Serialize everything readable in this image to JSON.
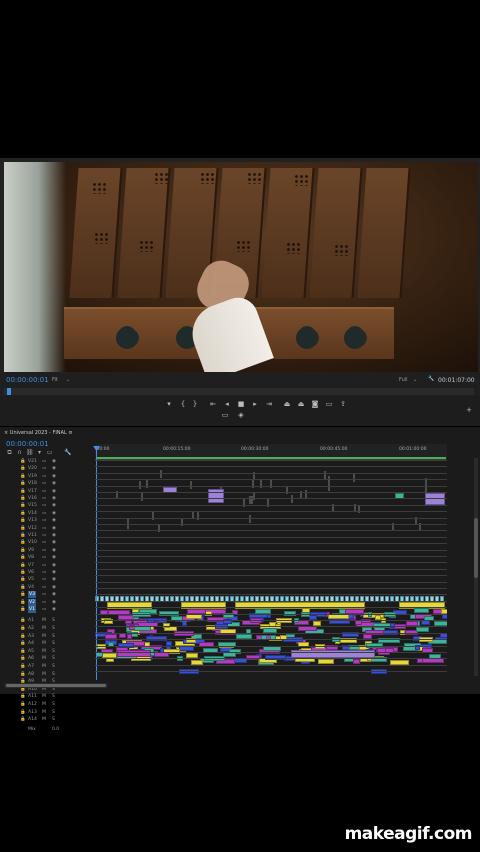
{
  "program_monitor": {
    "current_timecode": "00:00:00:01",
    "fit_label": "Fit",
    "resolution_label": "Full",
    "duration_timecode": "00:01:07:00"
  },
  "transport": {
    "buttons": [
      "mark-in",
      "mark-out",
      "go-to-in",
      "step-back",
      "play",
      "step-forward",
      "go-to-out",
      "lift",
      "extract",
      "export-frame",
      "comparison-view"
    ]
  },
  "timeline": {
    "sequence_name": "Universal 2023 - FINAL",
    "current_timecode": "00:00:00:01",
    "ruler_labels": [
      ":00:00",
      "00:00:15:00",
      "00:00:30:00",
      "00:00:45:00",
      "00:01:00:00"
    ],
    "video_tracks": [
      "V21",
      "V20",
      "V19",
      "V18",
      "V17",
      "V16",
      "V15",
      "V14",
      "V13",
      "V12",
      "V11",
      "V10",
      "V9",
      "V8",
      "V7",
      "V6",
      "V5",
      "V4",
      "V3",
      "V2",
      "V1"
    ],
    "audio_tracks": [
      "A1",
      "A2",
      "A3",
      "A4",
      "A5",
      "A6",
      "A7",
      "A8",
      "A9",
      "A10",
      "A11",
      "A12",
      "A13",
      "A14"
    ],
    "mix_label": "Mix",
    "mix_value": "0.0"
  },
  "watermark": "makeagif.com",
  "colors": {
    "accent": "#3d8fe6",
    "clip_yellow": "#e6d83a",
    "clip_teal": "#3fb39a",
    "clip_blue": "#3b4fd6",
    "clip_magenta": "#b03cc0",
    "clip_lavender": "#9c83d8",
    "clip_cyan": "#7fd3ea"
  }
}
